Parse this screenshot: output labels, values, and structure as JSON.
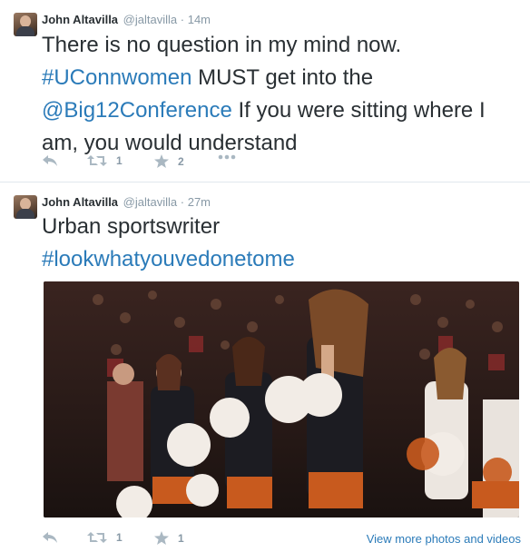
{
  "tweets": [
    {
      "name": "John Altavilla",
      "handle": "@jaltavilla",
      "separator": "·",
      "time": "14m",
      "text_parts": [
        "There is no question in my mind now.",
        "#UConnwomen",
        " MUST get into the",
        "@Big12Conference",
        " If you were sitting where I am, you would understand"
      ],
      "retweets": "1",
      "favorites": "2"
    },
    {
      "name": "John Altavilla",
      "handle": "@jaltavilla",
      "separator": "·",
      "time": "27m",
      "text_parts": [
        "Urban sportswriter",
        "#lookwhatyouvedonetome"
      ],
      "retweets": "1",
      "favorites": "1",
      "media_link": "View more photos and videos"
    }
  ],
  "colors": {
    "link": "#2b7bb9",
    "meta": "#8899a6",
    "text": "#292f33",
    "divider": "#e1e8ed"
  },
  "icons": [
    "reply-icon",
    "retweet-icon",
    "favorite-icon",
    "more-icon"
  ]
}
